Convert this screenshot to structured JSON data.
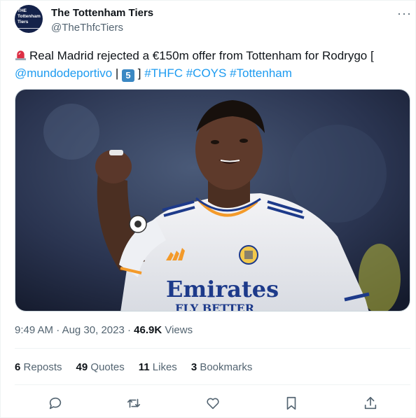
{
  "author": {
    "name": "The Tottenham Tiers",
    "handle": "@TheThfcTiers",
    "avatar_text": "THE Tottenham Tiers",
    "more_label": "···"
  },
  "tweet": {
    "text_main": "Real Madrid rejected a €150m offer from Tottenham for Rodrygo [",
    "mention": "@mundodeportivo",
    "separator": " | ",
    "keycap": "5",
    "bracket_close": " ]",
    "hashtags": " #THFC #COYS #Tottenham",
    "image_alt": "Rodrygo celebrating in a Real Madrid shirt",
    "shirt_text": "Emirates",
    "shirt_text_2": "FLY BETTER"
  },
  "meta": {
    "time": "9:49 AM",
    "dot1": " · ",
    "date": "Aug 30, 2023",
    "dot2": " · ",
    "views_count": "46.9K",
    "views_label": " Views"
  },
  "stats": [
    {
      "count": "6",
      "label": " Reposts"
    },
    {
      "count": "49",
      "label": " Quotes"
    },
    {
      "count": "11",
      "label": " Likes"
    },
    {
      "count": "3",
      "label": " Bookmarks"
    }
  ],
  "icons": {
    "reply": "reply-icon",
    "repost": "repost-icon",
    "like": "heart-icon",
    "bookmark": "bookmark-icon",
    "share": "share-icon"
  },
  "colors": {
    "link": "#1d9bf0",
    "muted": "#536471",
    "text": "#0f1419"
  }
}
